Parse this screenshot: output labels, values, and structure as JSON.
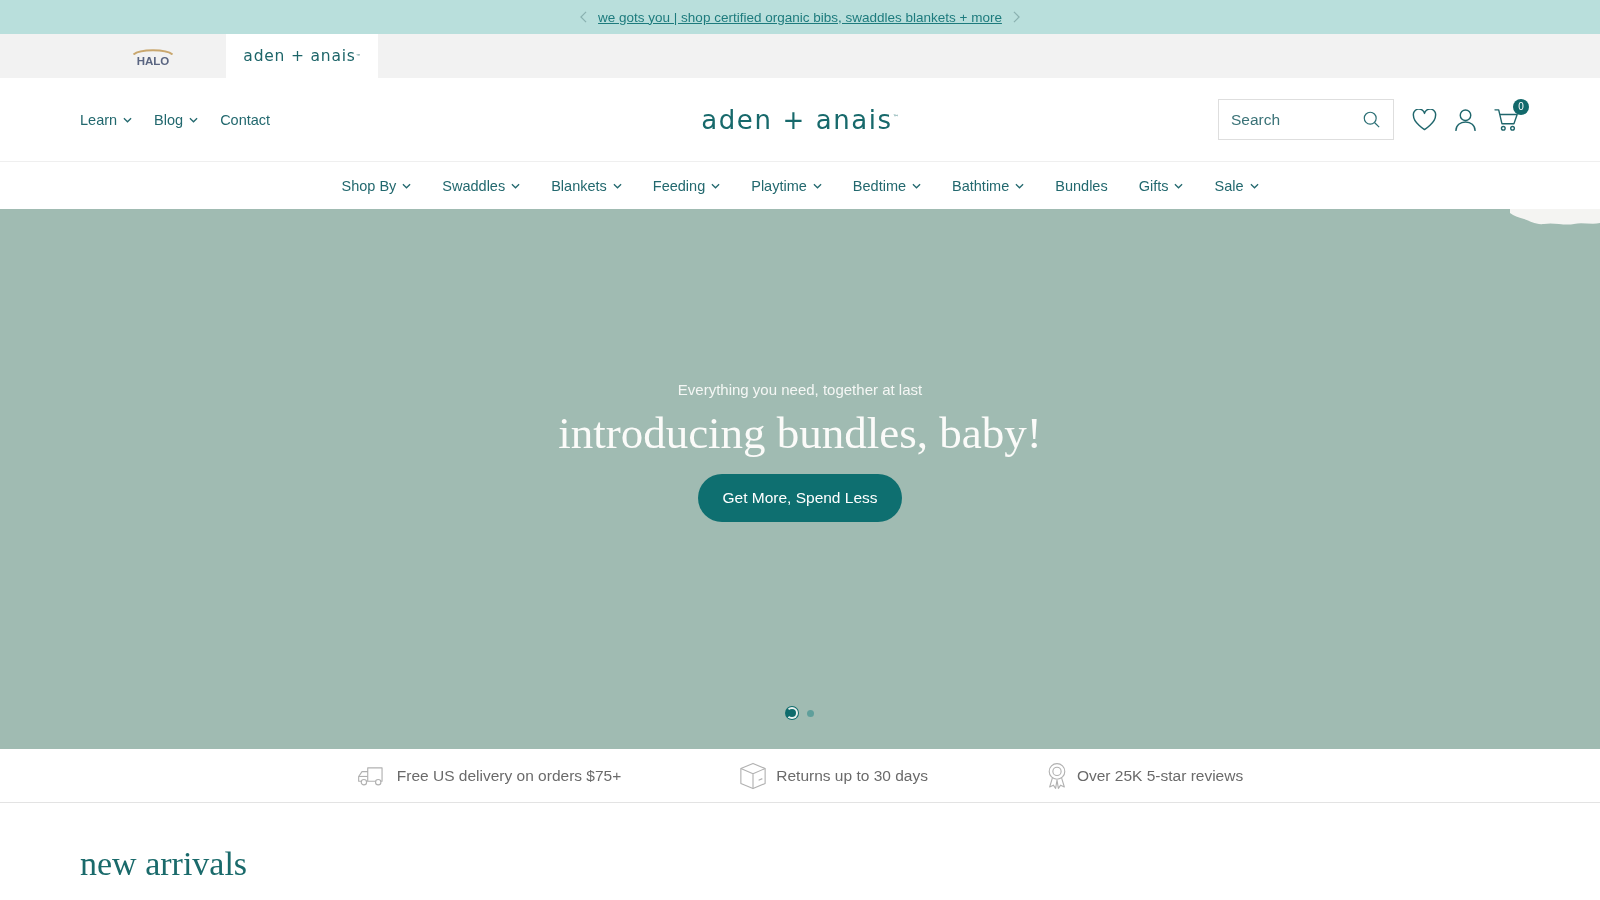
{
  "announcement_bar": {
    "text": "we gots you | shop certified organic bibs, swaddles blankets + more"
  },
  "brand_tabs": [
    {
      "kind": "halo",
      "label": "HALO",
      "selected": false
    },
    {
      "kind": "wordmark",
      "label": "aden + anais$^{™}$",
      "selected": true
    }
  ],
  "header": {
    "utility_links": [
      {
        "label": "Learn",
        "has_dropdown": true
      },
      {
        "label": "Blog",
        "has_dropdown": true
      },
      {
        "label": "Contact",
        "has_dropdown": false
      }
    ],
    "logo": "aden + anais$^{™}$",
    "search": {
      "placeholder": "Search"
    },
    "cart_count": "0"
  },
  "main_nav": [
    {
      "label": "Shop By",
      "has_dropdown": true
    },
    {
      "label": "Swaddles",
      "has_dropdown": true
    },
    {
      "label": "Blankets",
      "has_dropdown": true
    },
    {
      "label": "Feeding",
      "has_dropdown": true
    },
    {
      "label": "Playtime",
      "has_dropdown": true
    },
    {
      "label": "Bedtime",
      "has_dropdown": true
    },
    {
      "label": "Bathtime",
      "has_dropdown": true
    },
    {
      "label": "Bundles",
      "has_dropdown": false
    },
    {
      "label": "Gifts",
      "has_dropdown": true
    },
    {
      "label": "Sale",
      "has_dropdown": true
    }
  ],
  "hero": {
    "eyebrow": "Everything you need, together at last",
    "headline": "introducing bundles, baby!",
    "button": "Get More, Spend Less",
    "slides": [
      {
        "selected": true
      },
      {
        "selected": false
      }
    ]
  },
  "features": [
    {
      "kind": "truck",
      "text": "Free US delivery on orders $75+"
    },
    {
      "kind": "box",
      "text": "Returns up to 30 days"
    },
    {
      "kind": "award",
      "text": "Over 25K 5-star reviews"
    }
  ],
  "new_arrivals": {
    "title": "new arrivals"
  }
}
